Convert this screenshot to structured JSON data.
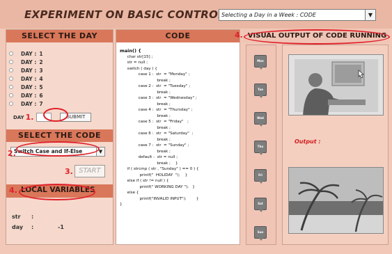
{
  "header": {
    "title": "EXPERIMENT ON BASIC CONTROL FLOW",
    "view_select": "Selecting a Day in a Week  : CODE"
  },
  "select_day": {
    "heading": "SELECT THE DAY",
    "days": [
      {
        "label": "DAY :",
        "value": "1"
      },
      {
        "label": "DAY :",
        "value": "2"
      },
      {
        "label": "DAY :",
        "value": "3"
      },
      {
        "label": "DAY :",
        "value": "4"
      },
      {
        "label": "DAY :",
        "value": "5"
      },
      {
        "label": "DAY :",
        "value": "6"
      },
      {
        "label": "DAY :",
        "value": "7"
      }
    ],
    "input_label": "DAY",
    "input_value": "",
    "submit_label": "SUBMIT"
  },
  "select_code": {
    "heading": "SELECT THE CODE",
    "selected": "Switch Case and If-Else",
    "start_label": "START"
  },
  "local_vars": {
    "heading": "LOCAL VARIABLES",
    "vars": [
      {
        "name": "str",
        "colon": ":",
        "value": ""
      },
      {
        "name": "day",
        "colon": ":",
        "value": "-1"
      }
    ]
  },
  "code": {
    "heading": "CODE",
    "lines": [
      "main() {",
      "      char str[15] ;",
      "      str = null ;",
      "      switch ( day ) {",
      "               case 1 :  str  = \"Monday\" ;",
      "                              break ;",
      "               case 2 :  str  = \"Tuesday\" ;",
      "                              break ;",
      "               case 3 :  str  = \"Wednesday\" ;",
      "                              break ;",
      "               case 4 :  str  = \"Thursday\" ;",
      "                              break ;",
      "               case 5 :  str  = \"Friday\"   ;",
      "                              break ;",
      "               case 6 :  str  = \"Saturday\"  ;",
      "                              break ;",
      "               case 7 :  str  = \"Sunday\" ;",
      "                              break ;",
      "               default :  str = null ;",
      "                              break ;    }",
      "      if ( strcmp ( str , \"Sunday\" ) == 0 ) {",
      "                printf(\"  HOLIDAY  \");    }",
      "      else if ( str != null ) {",
      "                printf(\" WORKING DAY \");   }",
      "      else {",
      "                printf(\"INVALID INPUT\");        }",
      "}"
    ]
  },
  "visual": {
    "heading": "VISUAL OUTPUT OF CODE RUNNING",
    "output_label": "Output :",
    "day_icons": [
      "Mon",
      "Tue",
      "Wed",
      "Thu",
      "Fri",
      "Sat",
      "Sun"
    ]
  },
  "annotations": {
    "n1": "1.",
    "n2": "2.",
    "n3": "3.",
    "n4a": "4.",
    "n4b": "4."
  },
  "colors": {
    "accent": "#d9775a",
    "annotation": "#e0202a",
    "panel_bg": "#f6d9cc"
  }
}
